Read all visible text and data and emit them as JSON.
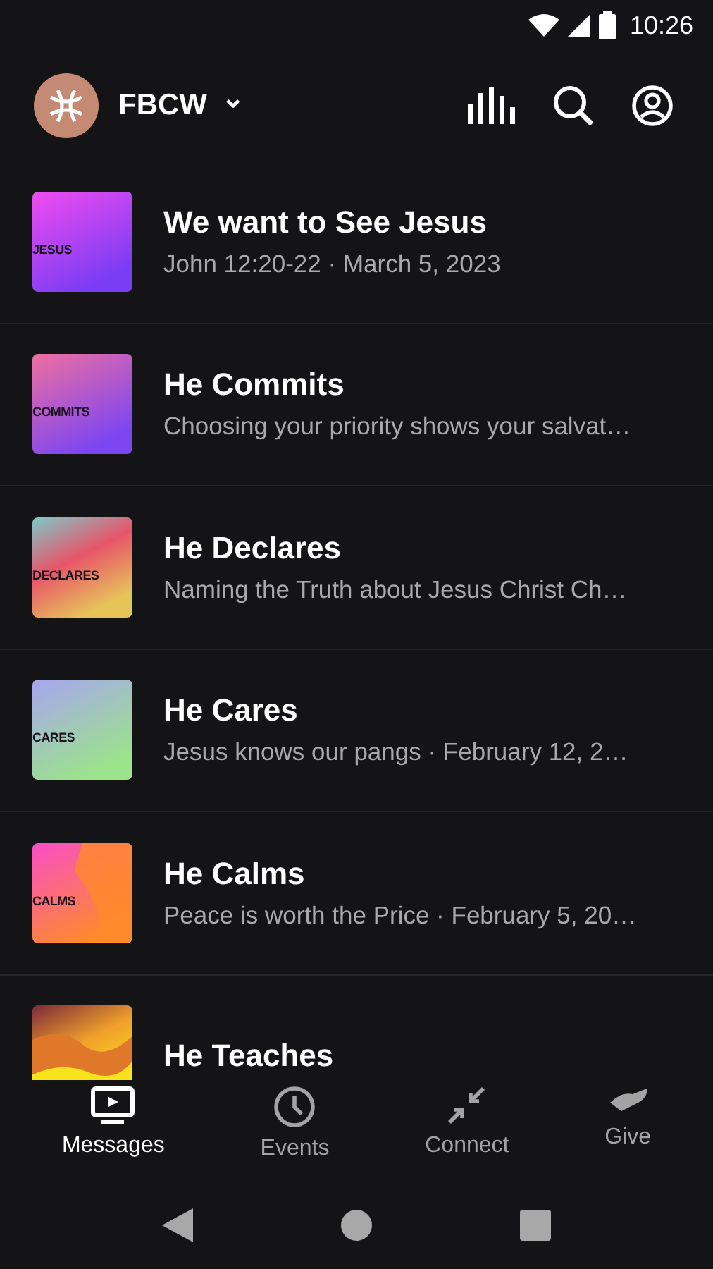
{
  "status_bar": {
    "time": "10:26"
  },
  "header": {
    "church": "FBCW",
    "dropdown_caret": "⌄"
  },
  "messages": [
    {
      "title": "We want to See Jesus",
      "subtitle": "John 12:20-22 · March 5, 2023",
      "art_label": "JESUS"
    },
    {
      "title": "He Commits",
      "subtitle": "Choosing your priority shows your salvat…",
      "art_label": "COMMITS"
    },
    {
      "title": "He Declares",
      "subtitle": "Naming the Truth about Jesus Christ Ch…",
      "art_label": "DECLARES"
    },
    {
      "title": "He Cares",
      "subtitle": "Jesus knows our pangs · February 12, 2…",
      "art_label": "CARES"
    },
    {
      "title": "He Calms",
      "subtitle": "Peace is worth the Price · February 5, 20…",
      "art_label": "CALMS"
    },
    {
      "title": "He Teaches"
    }
  ],
  "bottom_nav": [
    {
      "label": "Messages",
      "kind": "tv",
      "selected": true
    },
    {
      "label": "Events",
      "kind": "clock",
      "selected": false
    },
    {
      "label": "Connect",
      "kind": "arrows",
      "selected": false
    },
    {
      "label": "Give",
      "kind": "hand",
      "selected": false
    }
  ]
}
